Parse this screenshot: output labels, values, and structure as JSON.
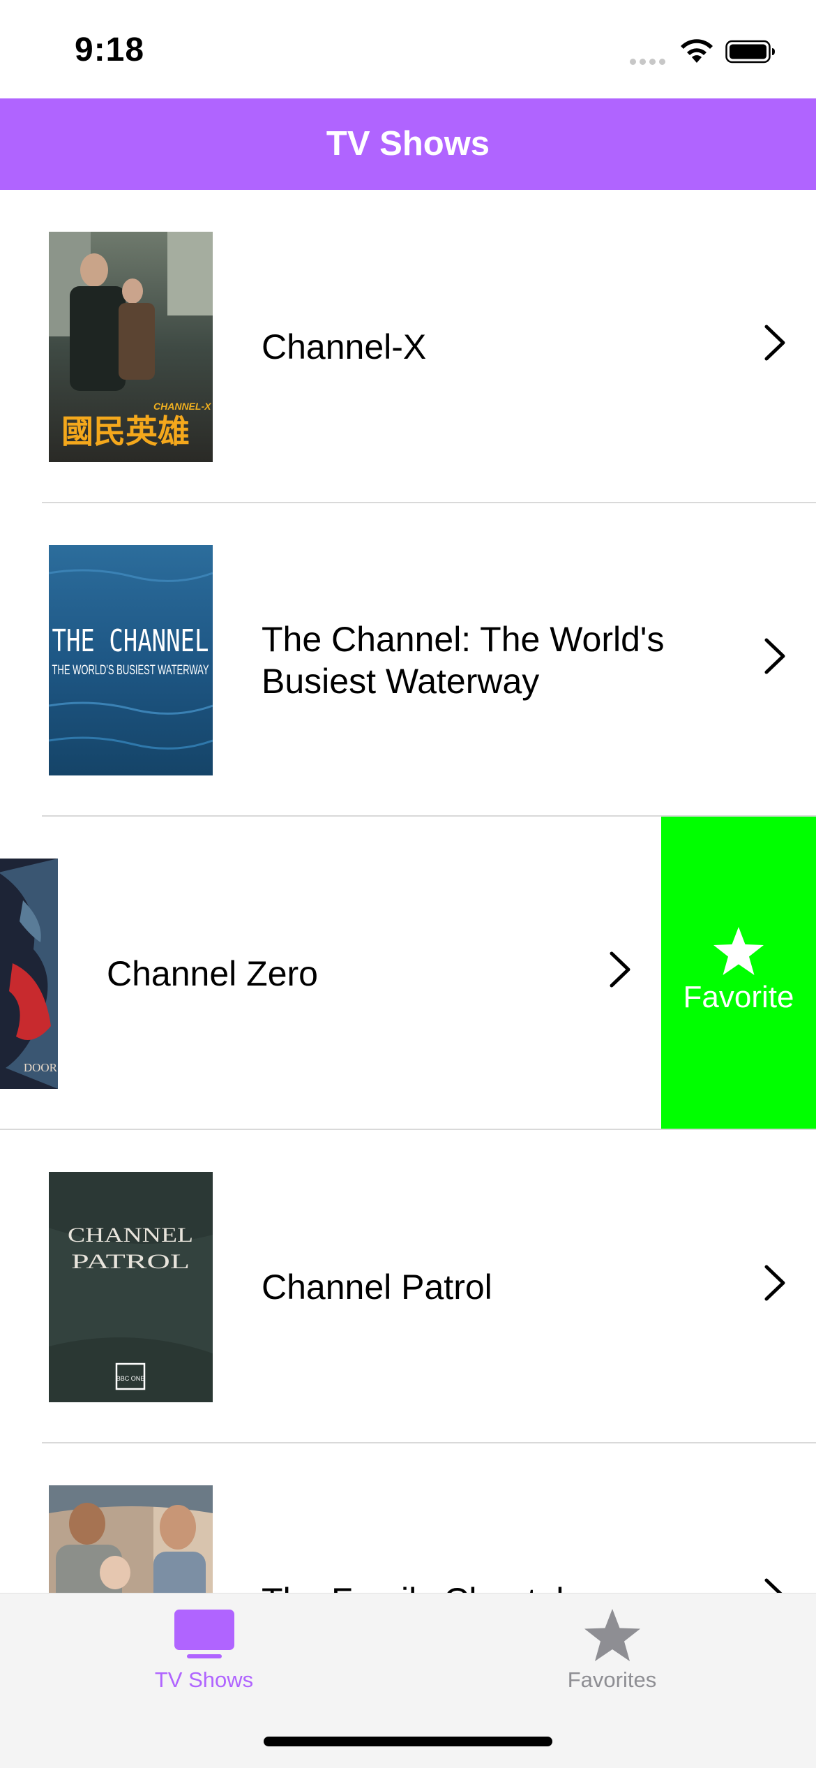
{
  "status": {
    "time": "9:18"
  },
  "nav": {
    "title": "TV Shows"
  },
  "colors": {
    "accent": "#b064ff",
    "favorite_action": "#00ff00",
    "tab_inactive": "#8e8e93"
  },
  "shows": [
    {
      "title": "Channel-X",
      "poster_text": [
        "CHANNEL-X",
        "國民英雄"
      ]
    },
    {
      "title": "The Channel: The World's Busiest Waterway",
      "poster_text": [
        "THE CHANNEL",
        "THE WORLD'S BUSIEST WATERWAY"
      ]
    },
    {
      "title": "Channel Zero",
      "poster_text": [
        "DOOR"
      ]
    },
    {
      "title": "Channel Patrol",
      "poster_text": [
        "CHANNEL",
        "PATROL",
        "BBC ONE"
      ]
    },
    {
      "title": "The Family Chantel:"
    }
  ],
  "swipe_action": {
    "label": "Favorite",
    "icon": "star-icon"
  },
  "tabs": [
    {
      "label": "TV Shows",
      "icon": "tv-icon",
      "selected": true
    },
    {
      "label": "Favorites",
      "icon": "star-icon",
      "selected": false
    }
  ]
}
